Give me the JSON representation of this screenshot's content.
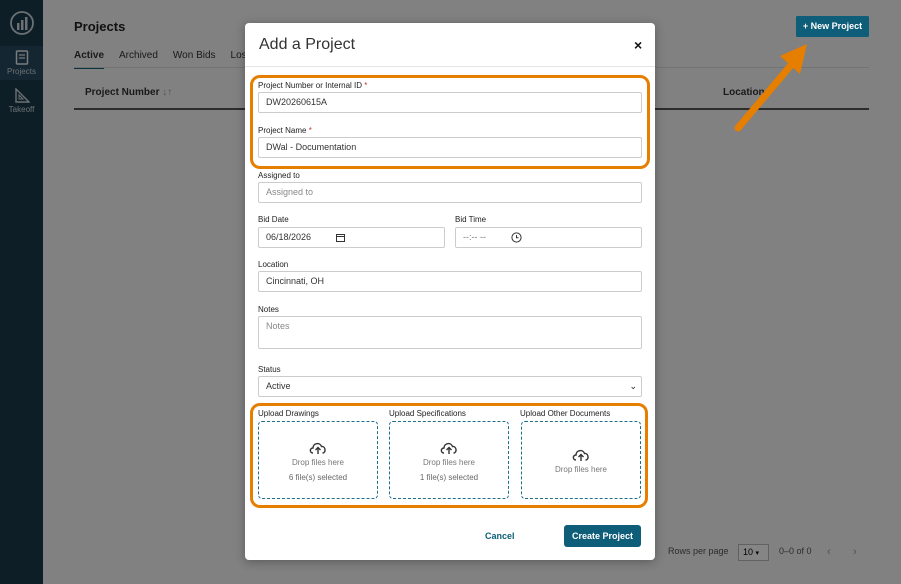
{
  "sidebar": {
    "items": [
      {
        "label": "Projects",
        "icon": "book-icon"
      },
      {
        "label": "Takeoff",
        "icon": "ruler-triangle-icon"
      }
    ]
  },
  "page": {
    "title": "Projects",
    "tabs": [
      "Active",
      "Archived",
      "Won Bids",
      "Lost"
    ],
    "columns": [
      "Project Number",
      "Location"
    ],
    "new_project_label": "+ New Project",
    "rows_per_page_label": "Rows per page",
    "rows_per_page_value": "10",
    "range_text": "0–0 of 0"
  },
  "modal": {
    "title": "Add a Project",
    "close_glyph": "×",
    "fields": {
      "project_number": {
        "label": "Project Number or Internal ID",
        "value": "DW20260615A"
      },
      "project_name": {
        "label": "Project Name",
        "value": "DWal - Documentation"
      },
      "assigned_to": {
        "label": "Assigned to",
        "placeholder": "Assigned to"
      },
      "bid_date": {
        "label": "Bid Date",
        "value": "06/18/2026"
      },
      "bid_time": {
        "label": "Bid Time",
        "value": "--:-- --"
      },
      "location": {
        "label": "Location",
        "value": "Cincinnati, OH"
      },
      "notes": {
        "label": "Notes",
        "placeholder": "Notes"
      },
      "status": {
        "label": "Status",
        "value": "Active"
      }
    },
    "required_mark": "*",
    "uploads": [
      {
        "label": "Upload Drawings",
        "drop_text": "Drop files here",
        "selected_text": "6 file(s) selected"
      },
      {
        "label": "Upload Specifications",
        "drop_text": "Drop files here",
        "selected_text": "1 file(s) selected"
      },
      {
        "label": "Upload Other Documents",
        "drop_text": "Drop files here",
        "selected_text": ""
      }
    ],
    "cancel_label": "Cancel",
    "create_label": "Create Project"
  },
  "colors": {
    "sidebar": "#1b3a4b",
    "primary": "#0f5e79",
    "highlight": "#e67e00"
  }
}
